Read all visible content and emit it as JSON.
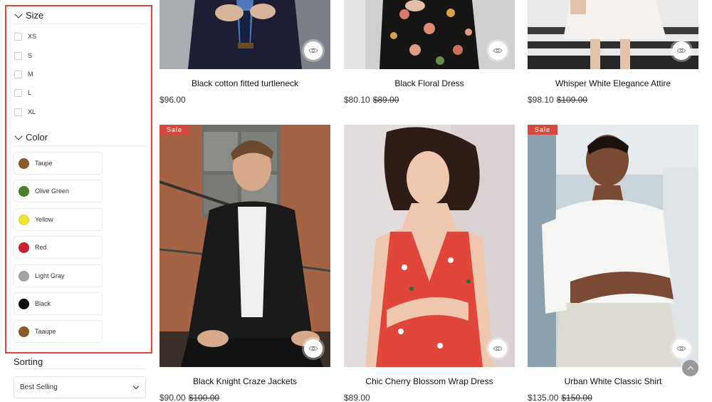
{
  "filters": {
    "size": {
      "title": "Size",
      "options": [
        "XS",
        "S",
        "M",
        "L",
        "XL"
      ]
    },
    "color": {
      "title": "Color",
      "options": [
        {
          "label": "Taupe",
          "color": "#8b5a2b"
        },
        {
          "label": "Olive Green",
          "color": "#4b7f2a"
        },
        {
          "label": "Yellow",
          "color": "#f2e233"
        },
        {
          "label": "Red",
          "color": "#c8232b"
        },
        {
          "label": "Light Gray",
          "color": "#a4a4a4"
        },
        {
          "label": "Black",
          "color": "#0d0d0d"
        },
        {
          "label": "Taaupe",
          "color": "#8b5a2b"
        }
      ]
    }
  },
  "sorting": {
    "title": "Sorting",
    "selected": "Best Selling"
  },
  "accent_color": "#d6493f",
  "products": [
    {
      "title": "Black cotton fitted turtleneck",
      "price": "$96.00",
      "old_price": "",
      "sale": false
    },
    {
      "title": "Black Floral Dress",
      "price": "$80.10",
      "old_price": "$89.00",
      "sale": false
    },
    {
      "title": "Whisper White Elegance Attire",
      "price": "$98.10",
      "old_price": "$109.00",
      "sale": false
    },
    {
      "title": "Black Knight Craze Jackets",
      "price": "$90.00",
      "old_price": "$100.00",
      "sale": true,
      "badge": "Sale"
    },
    {
      "title": "Chic Cherry Blossom Wrap Dress",
      "price": "$89.00",
      "old_price": "",
      "sale": false
    },
    {
      "title": "Urban White Classic Shirt",
      "price": "$135.00",
      "old_price": "$150.00",
      "sale": true,
      "badge": "Sale"
    }
  ]
}
